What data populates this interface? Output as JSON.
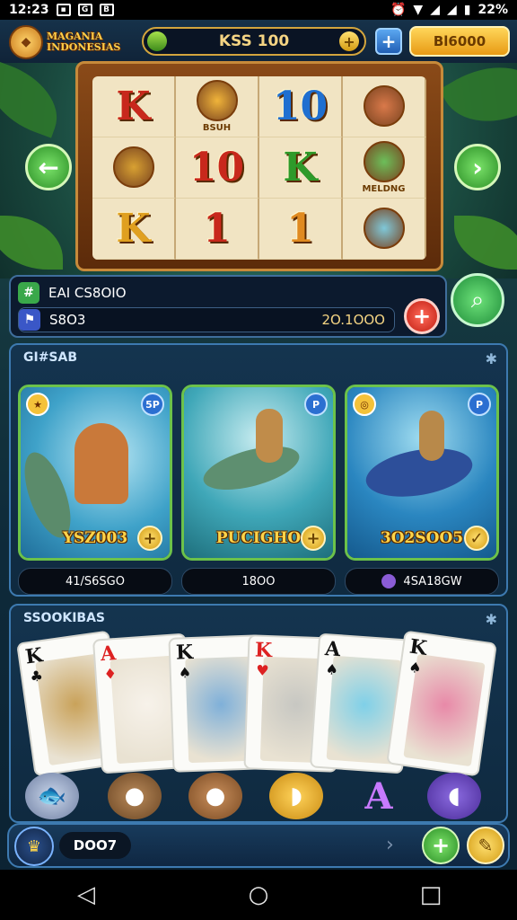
{
  "status_bar": {
    "time": "12:23",
    "battery": "22%"
  },
  "header": {
    "logo_line1": "MAGANIA",
    "logo_line2": "INDONESIAS",
    "balance": "KSS 100",
    "gold_button": "Bl6000"
  },
  "reels": {
    "symbols": [
      {
        "text": "K",
        "color": "#c8281c"
      },
      {
        "text": "",
        "face_label": "BSUH",
        "face_color": "#f0b43a"
      },
      {
        "text": "10",
        "color": "#1f6fd0"
      },
      {
        "text": "",
        "face_label": "",
        "face_color": "#d9794a"
      },
      {
        "text": "",
        "face_label": "",
        "face_color": "#d8a132"
      },
      {
        "text": "10",
        "color": "#c8281c"
      },
      {
        "text": "K",
        "color": "#2e9a2a"
      },
      {
        "text": "",
        "face_label": "MELDNG",
        "face_color": "#6cbf5a"
      },
      {
        "text": "K",
        "color": "#e0a020"
      },
      {
        "text": "1",
        "color": "#c8281c",
        "face_color": "#f0c040"
      },
      {
        "text": "1",
        "color": "#e08a20",
        "face_color": "#d69050"
      },
      {
        "text": "",
        "face_label": "",
        "face_color": "#7fc8d9"
      }
    ]
  },
  "info": {
    "row1_label": "EAI CS8OIO",
    "row2_label": "S8O3",
    "row2_value": "2O.1OOO"
  },
  "games_section": {
    "title": "GI#SAB",
    "cards": [
      {
        "label": "YSZ003",
        "badge_right": "5P"
      },
      {
        "label": "PUCIGHO",
        "badge_right": "P"
      },
      {
        "label": "3O2SOO5",
        "badge_right": "P"
      }
    ],
    "stats": [
      "41/S6SGO",
      "18OO",
      "4SA18GW"
    ]
  },
  "cards_section": {
    "title": "SSOOKIBAS",
    "playing_cards": [
      {
        "rank": "K",
        "suit": "♣",
        "color": "#111"
      },
      {
        "rank": "A",
        "suit": "♦",
        "color": "#d22"
      },
      {
        "rank": "K",
        "suit": "♠",
        "color": "#111"
      },
      {
        "rank": "K",
        "suit": "♥",
        "color": "#d22"
      },
      {
        "rank": "A",
        "suit": "♠",
        "color": "#111"
      },
      {
        "rank": "K",
        "suit": "♠",
        "color": "#111"
      }
    ]
  },
  "bottom_bar": {
    "name": "DOO7"
  }
}
